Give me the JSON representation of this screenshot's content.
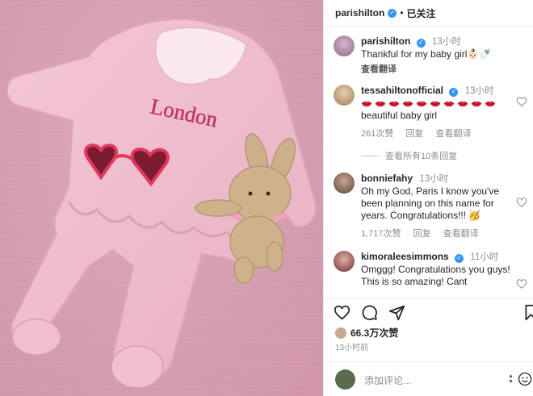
{
  "header": {
    "username": "parishilton",
    "separator": "•",
    "follow_label": "已关注"
  },
  "caption": {
    "username": "parishilton",
    "time": "13小时",
    "text": "Thankful for my baby girl👶🏻🍼",
    "translate": "查看翻译"
  },
  "comments": [
    {
      "username": "tessahiltonofficial",
      "time": "13小时",
      "lips_count": 10,
      "text": "beautiful baby girl",
      "likes": "261次赞",
      "reply": "回复",
      "translate": "查看翻译",
      "view_replies": "查看所有10条回复"
    },
    {
      "username": "bonniefahy",
      "time": "13小时",
      "text": "Oh my God, Paris I know you've been planning on this name for years. Congratulations!!! 🥳",
      "likes": "1,717次赞",
      "reply": "回复",
      "translate": "查看翻译"
    },
    {
      "username": "kimoraleesimmons",
      "time": "11小时",
      "text": "Omggg! Congratulations you guys! This is so amazing! Cant"
    }
  ],
  "post": {
    "likes": "66.3万次赞",
    "time": "13小时前"
  },
  "add_comment": {
    "placeholder": "添加评论..."
  },
  "photo": {
    "onesie_text": "London"
  },
  "icons": [
    "verified-badge-icon",
    "heart-icon",
    "comment-icon",
    "share-icon",
    "bookmark-icon",
    "emoji-icon",
    "lips-emoji-icon"
  ],
  "colors": {
    "verified": "#3897f0",
    "secondary_text": "#8e8e8e",
    "photo_background": "#d9a2b4"
  }
}
